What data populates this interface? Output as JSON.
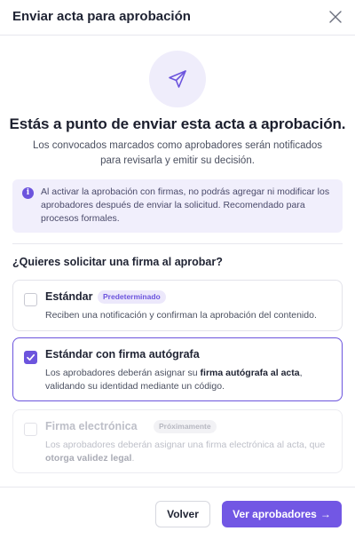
{
  "dialog": {
    "title": "Enviar acta para aprobación",
    "headline": "Estás a punto de enviar esta acta a aprobación.",
    "subtext": "Los convocados marcados como aprobadores serán notificados para revisarla y emitir su decisión.",
    "info": {
      "icon": "info-icon",
      "text": "Al activar la aprobación con firmas, no podrás agregar ni modificar los aprobadores después de enviar la solicitud. Recomendado para procesos formales."
    },
    "question": "¿Quieres solicitar una firma al aprobar?",
    "options": [
      {
        "title": "Estándar",
        "badge": "Predeterminado",
        "description": "Reciben una notificación y confirman la aprobación del contenido.",
        "checked": false
      },
      {
        "title": "Estándar con firma autógrafa",
        "desc_before": "Los aprobadores deberán asignar su ",
        "desc_bold": "firma autógrafa al acta",
        "desc_after": ", validando su identidad mediante un código.",
        "checked": true
      },
      {
        "title": "Firma electrónica",
        "badge": "Próximamente",
        "desc_before": "Los aprobadores deberán asignar una firma electrónica al acta, que ",
        "desc_bold": "otorga validez legal",
        "desc_after": ".",
        "checked": false,
        "disabled": true
      }
    ],
    "footer": {
      "back_label": "Volver",
      "next_label": "Ver aprobadores",
      "next_arrow": "→"
    }
  },
  "colors": {
    "accent": "#6c54dd",
    "accent_light": "#f1effc",
    "primary_button": "#7257e4"
  }
}
